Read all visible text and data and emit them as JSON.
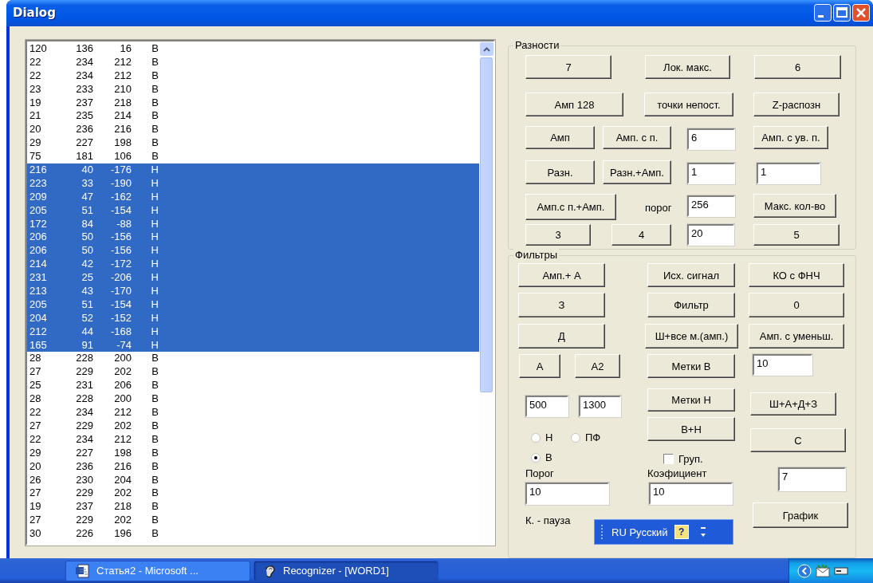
{
  "window": {
    "title": "Dialog"
  },
  "list": {
    "rows": [
      {
        "cells": [
          "120",
          "136",
          "16",
          "В"
        ],
        "selected": false
      },
      {
        "cells": [
          "22",
          "234",
          "212",
          "В"
        ],
        "selected": false
      },
      {
        "cells": [
          "22",
          "234",
          "212",
          "В"
        ],
        "selected": false
      },
      {
        "cells": [
          "23",
          "233",
          "210",
          "В"
        ],
        "selected": false
      },
      {
        "cells": [
          "19",
          "237",
          "218",
          "В"
        ],
        "selected": false
      },
      {
        "cells": [
          "21",
          "235",
          "214",
          "В"
        ],
        "selected": false
      },
      {
        "cells": [
          "20",
          "236",
          "216",
          "В"
        ],
        "selected": false
      },
      {
        "cells": [
          "29",
          "227",
          "198",
          "В"
        ],
        "selected": false
      },
      {
        "cells": [
          "75",
          "181",
          "106",
          "В"
        ],
        "selected": false
      },
      {
        "cells": [
          "216",
          "40",
          "-176",
          "Н"
        ],
        "selected": true
      },
      {
        "cells": [
          "223",
          "33",
          "-190",
          "Н"
        ],
        "selected": true
      },
      {
        "cells": [
          "209",
          "47",
          "-162",
          "Н"
        ],
        "selected": true
      },
      {
        "cells": [
          "205",
          "51",
          "-154",
          "Н"
        ],
        "selected": true
      },
      {
        "cells": [
          "172",
          "84",
          "-88",
          "Н"
        ],
        "selected": true
      },
      {
        "cells": [
          "206",
          "50",
          "-156",
          "Н"
        ],
        "selected": true
      },
      {
        "cells": [
          "206",
          "50",
          "-156",
          "Н"
        ],
        "selected": true
      },
      {
        "cells": [
          "214",
          "42",
          "-172",
          "Н"
        ],
        "selected": true
      },
      {
        "cells": [
          "231",
          "25",
          "-206",
          "Н"
        ],
        "selected": true
      },
      {
        "cells": [
          "213",
          "43",
          "-170",
          "Н"
        ],
        "selected": true
      },
      {
        "cells": [
          "205",
          "51",
          "-154",
          "Н"
        ],
        "selected": true
      },
      {
        "cells": [
          "204",
          "52",
          "-152",
          "Н"
        ],
        "selected": true
      },
      {
        "cells": [
          "212",
          "44",
          "-168",
          "Н"
        ],
        "selected": true
      },
      {
        "cells": [
          "165",
          "91",
          "-74",
          "Н"
        ],
        "selected": true
      },
      {
        "cells": [
          "28",
          "228",
          "200",
          "В"
        ],
        "selected": false
      },
      {
        "cells": [
          "27",
          "229",
          "202",
          "В"
        ],
        "selected": false
      },
      {
        "cells": [
          "25",
          "231",
          "206",
          "В"
        ],
        "selected": false
      },
      {
        "cells": [
          "28",
          "228",
          "200",
          "В"
        ],
        "selected": false
      },
      {
        "cells": [
          "22",
          "234",
          "212",
          "В"
        ],
        "selected": false
      },
      {
        "cells": [
          "27",
          "229",
          "202",
          "В"
        ],
        "selected": false
      },
      {
        "cells": [
          "22",
          "234",
          "212",
          "В"
        ],
        "selected": false
      },
      {
        "cells": [
          "29",
          "227",
          "198",
          "В"
        ],
        "selected": false
      },
      {
        "cells": [
          "20",
          "236",
          "216",
          "В"
        ],
        "selected": false
      },
      {
        "cells": [
          "26",
          "230",
          "204",
          "В"
        ],
        "selected": false
      },
      {
        "cells": [
          "27",
          "229",
          "202",
          "В"
        ],
        "selected": false
      },
      {
        "cells": [
          "19",
          "237",
          "218",
          "В"
        ],
        "selected": false
      },
      {
        "cells": [
          "27",
          "229",
          "202",
          "В"
        ],
        "selected": false
      },
      {
        "cells": [
          "30",
          "226",
          "196",
          "В"
        ],
        "selected": false
      }
    ]
  },
  "groups": [
    {
      "title": "Разности",
      "controls": [
        {
          "kind": "button",
          "label": "7"
        },
        {
          "kind": "button",
          "label": "Лок. макс."
        },
        {
          "kind": "button",
          "label": "6"
        },
        {
          "kind": "button",
          "label": "Амп 128"
        },
        {
          "kind": "button",
          "label": "точки непост."
        },
        {
          "kind": "button",
          "label": "Z-распозн"
        },
        {
          "kind": "button",
          "label": "Амп"
        },
        {
          "kind": "button",
          "label": "Амп. с п."
        },
        {
          "kind": "field",
          "value": "6"
        },
        {
          "kind": "button",
          "label": "Амп. с ув. п."
        },
        {
          "kind": "button",
          "label": "Разн."
        },
        {
          "kind": "button",
          "label": "Разн.+Амп."
        },
        {
          "kind": "field",
          "value": "1"
        },
        {
          "kind": "field",
          "value": "1"
        },
        {
          "kind": "button",
          "label": "Амп.с п.+Амп."
        },
        {
          "kind": "label",
          "text": "порог"
        },
        {
          "kind": "field",
          "value": "256"
        },
        {
          "kind": "button",
          "label": "Макс. кол-во"
        },
        {
          "kind": "button",
          "label": "3"
        },
        {
          "kind": "button",
          "label": "4"
        },
        {
          "kind": "field",
          "value": "20"
        },
        {
          "kind": "button",
          "label": "5"
        }
      ]
    },
    {
      "title": "Фильтры",
      "controls": [
        {
          "kind": "button",
          "label": "Амп.+ А"
        },
        {
          "kind": "button",
          "label": "Исх. сигнал"
        },
        {
          "kind": "button",
          "label": "КО с ФНЧ"
        },
        {
          "kind": "button",
          "label": "З"
        },
        {
          "kind": "button",
          "label": "Фильтр"
        },
        {
          "kind": "button",
          "label": "0"
        },
        {
          "kind": "button",
          "label": "Д"
        },
        {
          "kind": "button",
          "label": "Ш+все м.(амп.)"
        },
        {
          "kind": "button",
          "label": "Амп. с уменьш."
        },
        {
          "kind": "button",
          "label": "А"
        },
        {
          "kind": "button",
          "label": "А2"
        },
        {
          "kind": "button",
          "label": "Метки В"
        },
        {
          "kind": "field",
          "value": "10"
        },
        {
          "kind": "field",
          "value": "500"
        },
        {
          "kind": "field",
          "value": "1300"
        },
        {
          "kind": "button",
          "label": "Метки Н"
        },
        {
          "kind": "button",
          "label": "Ш+А+Д+З"
        },
        {
          "kind": "radio",
          "label": "Н",
          "selected": false
        },
        {
          "kind": "radio",
          "label": "ПФ",
          "selected": false
        },
        {
          "kind": "button",
          "label": "В+Н"
        },
        {
          "kind": "button",
          "label": "С"
        },
        {
          "kind": "radio",
          "label": "В",
          "selected": true
        },
        {
          "kind": "checkbox",
          "label": "Груп.",
          "checked": false
        },
        {
          "kind": "label",
          "text": "Порог"
        },
        {
          "kind": "label",
          "text": "Коэфициент"
        },
        {
          "kind": "field",
          "value": "7"
        },
        {
          "kind": "field",
          "value": "10"
        },
        {
          "kind": "field",
          "value": "10"
        },
        {
          "kind": "label",
          "text": "К. - пауза"
        },
        {
          "kind": "button",
          "label": "График"
        }
      ]
    }
  ],
  "language_bar": {
    "label": "RU Русский",
    "help": "?"
  },
  "taskbar": {
    "buttons": [
      {
        "label": "Статья2 - Microsoft ...",
        "selected": false
      },
      {
        "label": "Recognizer - [WORD1]",
        "selected": true
      }
    ]
  }
}
